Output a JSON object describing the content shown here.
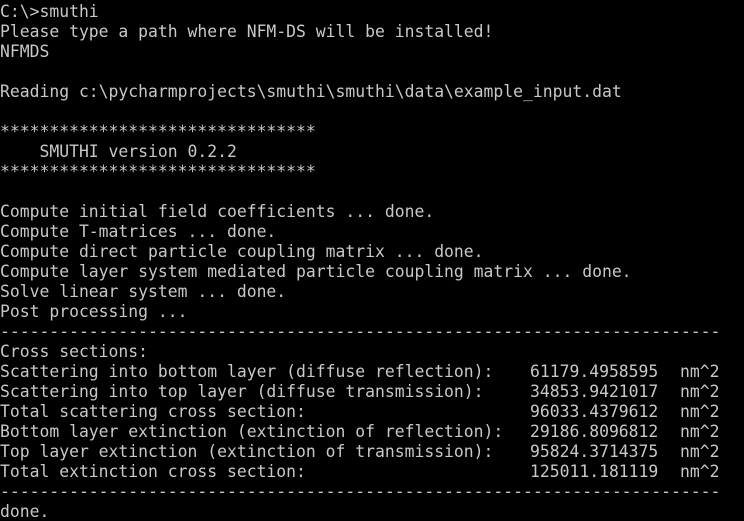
{
  "console": {
    "prompt": "C:\\>smuthi",
    "install_prompt": "Please type a path where NFM-DS will be installed!",
    "install_answer": "NFMDS",
    "reading": "Reading c:\\pycharmprojects\\smuthi\\smuthi\\data\\example_input.dat",
    "stars_top": "********************************",
    "version": "    SMUTHI version 0.2.2",
    "stars_bottom": "********************************",
    "steps": [
      "Compute initial field coefficients ... done.",
      "Compute T-matrices ... done.",
      "Compute direct particle coupling matrix ... done.",
      "Compute layer system mediated particle coupling matrix ... done.",
      "Solve linear system ... done.",
      "Post processing ..."
    ],
    "separator": "-------------------------------------------------------------------------",
    "cross_sections_heading": "Cross sections:",
    "results": [
      {
        "label": "Scattering into bottom layer (diffuse reflection):",
        "value": "61179.4958595",
        "unit": "nm^2"
      },
      {
        "label": "Scattering into top layer (diffuse transmission):",
        "value": "34853.9421017",
        "unit": "nm^2"
      },
      {
        "label": "Total scattering cross section:",
        "value": "96033.4379612",
        "unit": "nm^2"
      },
      {
        "label": "Bottom layer extinction (extinction of reflection):",
        "value": "29186.8096812",
        "unit": "nm^2"
      },
      {
        "label": "Top layer extinction (extinction of transmission):",
        "value": "95824.3714375",
        "unit": "nm^2"
      },
      {
        "label": "Total extinction cross section:",
        "value": "125011.181119",
        "unit": "nm^2"
      }
    ],
    "done": "done."
  },
  "colors": {
    "background": "#000000",
    "text": "#c8c8c8"
  }
}
